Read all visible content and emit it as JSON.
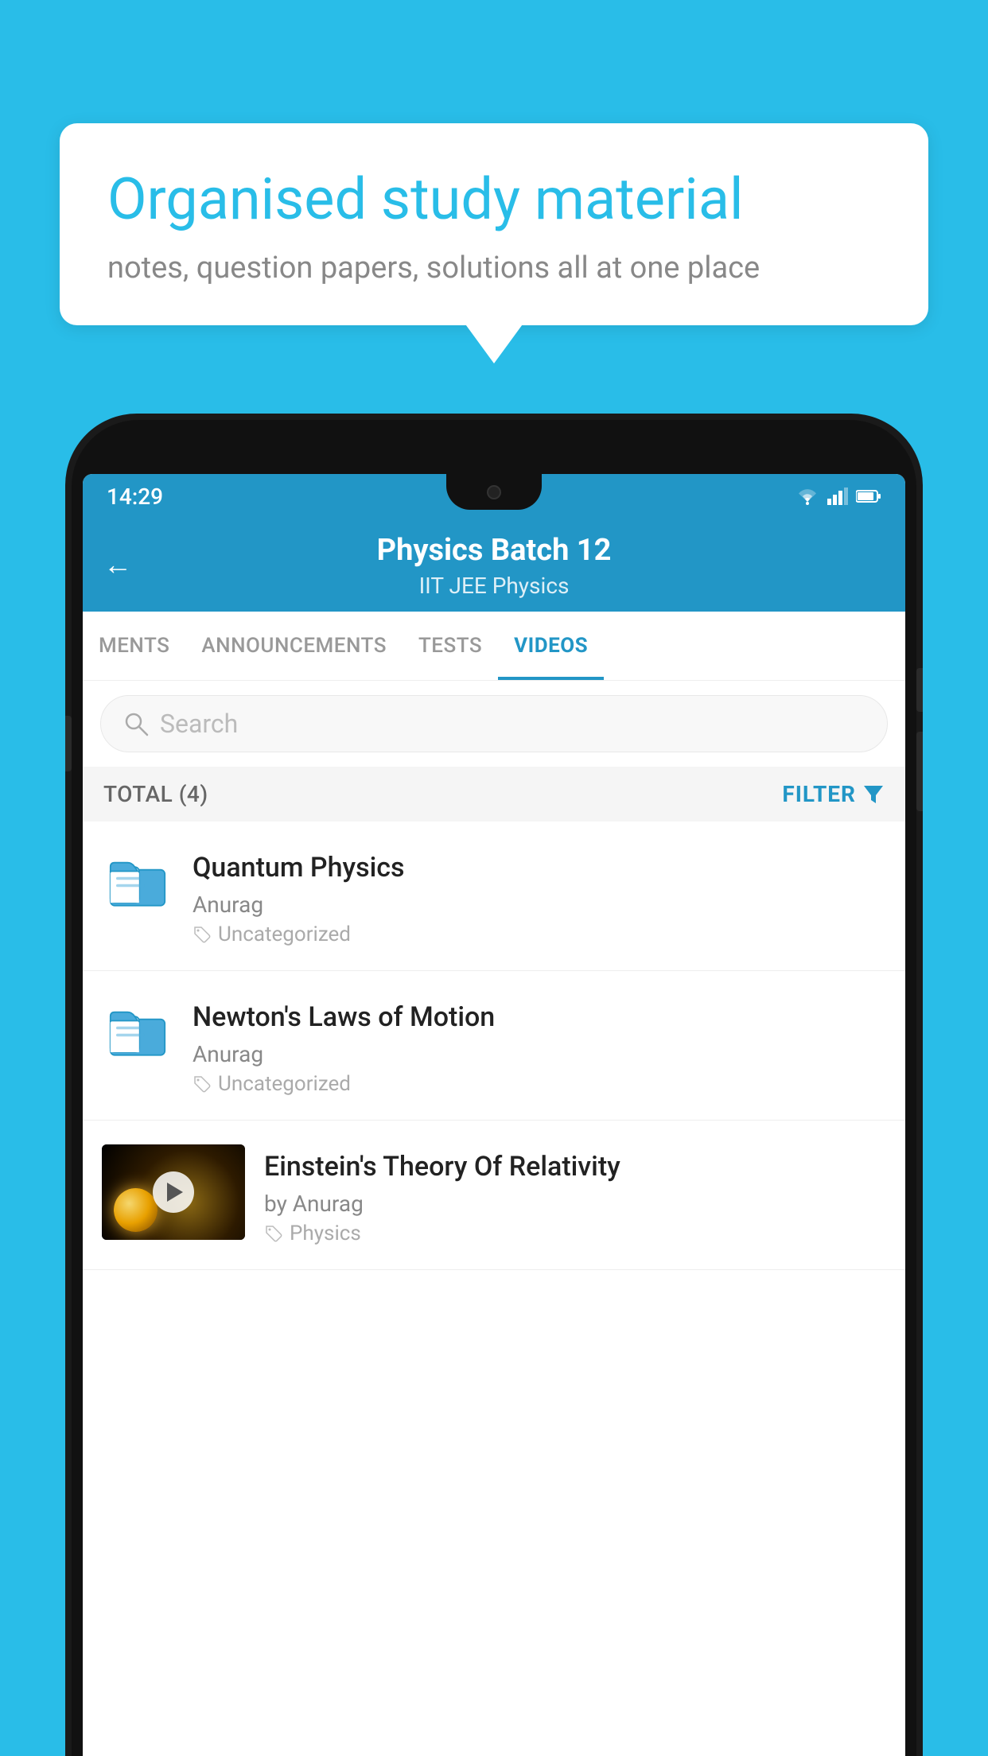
{
  "bubble": {
    "title": "Organised study material",
    "subtitle": "notes, question papers, solutions all at one place"
  },
  "status_bar": {
    "time": "14:29"
  },
  "header": {
    "title": "Physics Batch 12",
    "subtitle": "IIT JEE   Physics",
    "back_label": "←"
  },
  "tabs": [
    {
      "label": "MENTS",
      "active": false
    },
    {
      "label": "ANNOUNCEMENTS",
      "active": false
    },
    {
      "label": "TESTS",
      "active": false
    },
    {
      "label": "VIDEOS",
      "active": true
    }
  ],
  "search": {
    "placeholder": "Search"
  },
  "filter_bar": {
    "total_label": "TOTAL (4)",
    "filter_label": "FILTER"
  },
  "videos": [
    {
      "id": 1,
      "title": "Quantum Physics",
      "author": "Anurag",
      "tag": "Uncategorized",
      "has_thumbnail": false
    },
    {
      "id": 2,
      "title": "Newton's Laws of Motion",
      "author": "Anurag",
      "tag": "Uncategorized",
      "has_thumbnail": false
    },
    {
      "id": 3,
      "title": "Einstein's Theory Of Relativity",
      "author": "by Anurag",
      "tag": "Physics",
      "has_thumbnail": true
    }
  ],
  "colors": {
    "primary": "#2296C6",
    "background": "#29BDE8",
    "accent": "#2296C6"
  }
}
